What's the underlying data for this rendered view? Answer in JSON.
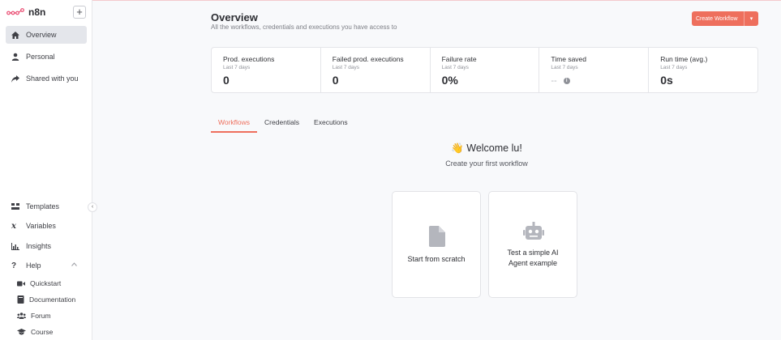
{
  "colors": {
    "accent": "#ee6f5d",
    "sidebar_active": "#e4e6eb",
    "icon_gray": "#b4b6bd"
  },
  "app": {
    "logo_text": "n8n"
  },
  "sidebar": {
    "top_items": [
      {
        "label": "Overview",
        "icon": "home-icon",
        "active": true
      },
      {
        "label": "Personal",
        "icon": "user-icon"
      },
      {
        "label": "Shared with you",
        "icon": "share-icon"
      }
    ],
    "bottom_items": [
      {
        "label": "Templates",
        "icon": "templates-icon"
      },
      {
        "label": "Variables",
        "icon": "variables-icon"
      },
      {
        "label": "Insights",
        "icon": "insights-icon"
      },
      {
        "label": "Help",
        "icon": "help-icon"
      }
    ],
    "help_items": [
      {
        "label": "Quickstart",
        "icon": "video-icon"
      },
      {
        "label": "Documentation",
        "icon": "book-icon"
      },
      {
        "label": "Forum",
        "icon": "users-icon"
      },
      {
        "label": "Course",
        "icon": "graduation-cap-icon"
      }
    ]
  },
  "header": {
    "title": "Overview",
    "subtitle": "All the workflows, credentials and executions you have access to",
    "create_button": "Create Workflow"
  },
  "stats": [
    {
      "label": "Prod. executions",
      "period": "Last 7 days",
      "value": "0"
    },
    {
      "label": "Failed prod. executions",
      "period": "Last 7 days",
      "value": "0"
    },
    {
      "label": "Failure rate",
      "period": "Last 7 days",
      "value": "0%"
    },
    {
      "label": "Time saved",
      "period": "Last 7 days",
      "value": "--"
    },
    {
      "label": "Run time (avg.)",
      "period": "Last 7 days",
      "value": "0s"
    }
  ],
  "tabs": [
    {
      "label": "Workflows",
      "active": true
    },
    {
      "label": "Credentials"
    },
    {
      "label": "Executions"
    }
  ],
  "welcome": {
    "emoji": "👋",
    "title": "Welcome lu!",
    "subtitle": "Create your first workflow"
  },
  "cards": [
    {
      "title": "Start from scratch",
      "icon": "file-icon"
    },
    {
      "title": "Test a simple AI Agent example",
      "icon": "robot-icon"
    }
  ]
}
